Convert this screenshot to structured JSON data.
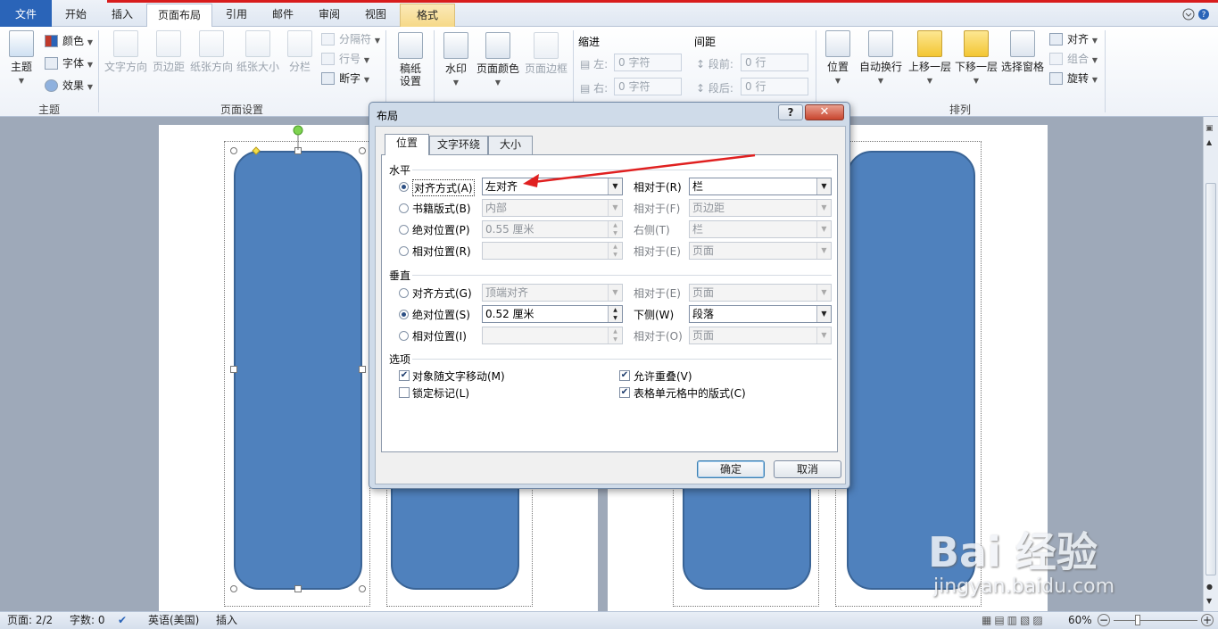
{
  "tabs": {
    "file": "文件",
    "home": "开始",
    "insert": "插入",
    "page_layout": "页面布局",
    "references": "引用",
    "mailings": "邮件",
    "review": "审阅",
    "view": "视图",
    "format": "格式"
  },
  "ribbon": {
    "theme": {
      "themes": "主题",
      "colors": "颜色",
      "fonts": "字体",
      "effects": "效果",
      "group": "主题"
    },
    "page_setup": {
      "text_direction": "文字方向",
      "margins": "页边距",
      "orientation": "纸张方向",
      "size": "纸张大小",
      "columns": "分栏",
      "breaks": "分隔符",
      "line_numbers": "行号",
      "hyphenation": "断字",
      "group": "页面设置"
    },
    "manuscript": {
      "label_line1": "稿纸",
      "label_line2": "设置"
    },
    "background": {
      "watermark": "水印",
      "page_color": "页面颜色",
      "page_borders": "页面边框"
    },
    "paragraph": {
      "indent": "缩进",
      "indent_left": "左:",
      "indent_left_val": "0 字符",
      "indent_right": "右:",
      "indent_right_val": "0 字符",
      "spacing": "间距",
      "spacing_before": "段前:",
      "spacing_before_val": "0 行",
      "spacing_after": "段后:",
      "spacing_after_val": "0 行"
    },
    "arrange": {
      "position": "位置",
      "wrap_text": "自动换行",
      "bring_forward": "上移一层",
      "send_backward": "下移一层",
      "selection_pane": "选择窗格",
      "align": "对齐",
      "group_objects": "组合",
      "rotate": "旋转",
      "group": "排列"
    }
  },
  "dialog": {
    "title": "布局",
    "help": "?",
    "close": "✕",
    "tabs": {
      "position": "位置",
      "text_wrapping": "文字环绕",
      "size": "大小"
    },
    "horizontal": {
      "section": "水平",
      "alignment": "对齐方式(A)",
      "alignment_value": "左对齐",
      "alignment_rel_label": "相对于(R)",
      "alignment_rel_value": "栏",
      "book_layout": "书籍版式(B)",
      "book_layout_value": "内部",
      "book_layout_rel_label": "相对于(F)",
      "book_layout_rel_value": "页边距",
      "absolute": "绝对位置(P)",
      "absolute_value": "0.55 厘米",
      "absolute_rel_label": "右侧(T)",
      "absolute_rel_value": "栏",
      "relative": "相对位置(R)",
      "relative_value": "",
      "relative_rel_label": "相对于(E)",
      "relative_rel_value": "页面"
    },
    "vertical": {
      "section": "垂直",
      "alignment": "对齐方式(G)",
      "alignment_value": "顶端对齐",
      "alignment_rel_label": "相对于(E)",
      "alignment_rel_value": "页面",
      "absolute": "绝对位置(S)",
      "absolute_value": "0.52 厘米",
      "absolute_rel_label": "下侧(W)",
      "absolute_rel_value": "段落",
      "relative": "相对位置(I)",
      "relative_value": "",
      "relative_rel_label": "相对于(O)",
      "relative_rel_value": "页面"
    },
    "options": {
      "section": "选项",
      "move_with_text": "对象随文字移动(M)",
      "move_with_text_checked": true,
      "lock_anchor": "锁定标记(L)",
      "lock_anchor_checked": false,
      "allow_overlap": "允许重叠(V)",
      "allow_overlap_checked": true,
      "layout_in_cell": "表格单元格中的版式(C)",
      "layout_in_cell_checked": true
    },
    "ok": "确定",
    "cancel": "取消"
  },
  "status_bar": {
    "page": "页面: 2/2",
    "words": "字数: 0",
    "language": "英语(美国)",
    "mode": "插入",
    "zoom": "60%",
    "zoom_minus": "−",
    "zoom_plus": "+"
  },
  "watermark": {
    "logo": "Bai 经验",
    "url": "jingyan.baidu.com"
  },
  "colors": {
    "shape_fill": "#4f81bd",
    "annotation_arrow": "#e02020",
    "file_tab": "#2a64b8"
  }
}
